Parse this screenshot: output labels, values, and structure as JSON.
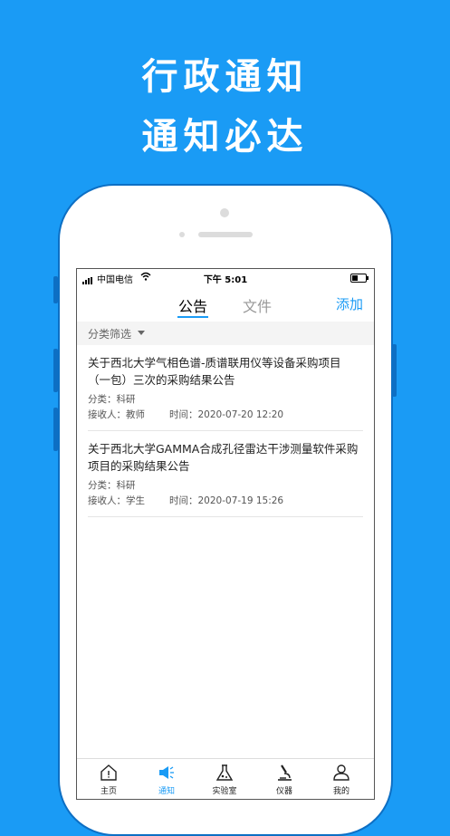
{
  "promo": {
    "line1": "行政通知",
    "line2": "通知必达"
  },
  "status": {
    "carrier": "中国电信",
    "time": "下午 5:01"
  },
  "nav": {
    "tab_announcement": "公告",
    "tab_files": "文件",
    "add": "添加"
  },
  "filter": {
    "label": "分类筛选"
  },
  "items": [
    {
      "title": "关于西北大学气相色谱-质谱联用仪等设备采购项目（一包）三次的采购结果公告",
      "category": "分类：科研",
      "receiver": "接收人：教师",
      "time": "时间：2020-07-20  12:20"
    },
    {
      "title": "关于西北大学GAMMA合成孔径雷达干涉测量软件采购项目的采购结果公告",
      "category": "分类：科研",
      "receiver": "接收人：学生",
      "time": "时间：2020-07-19  15:26"
    }
  ],
  "tabbar": {
    "home": "主页",
    "notice": "通知",
    "lab": "实验室",
    "instrument": "仪器",
    "mine": "我的"
  },
  "colors": {
    "brand": "#1a9bf5"
  },
  "icons": [
    "signal-icon",
    "wifi-icon",
    "battery-icon",
    "caret-down-icon",
    "home-icon",
    "megaphone-icon",
    "flask-icon",
    "microscope-icon",
    "user-icon"
  ]
}
